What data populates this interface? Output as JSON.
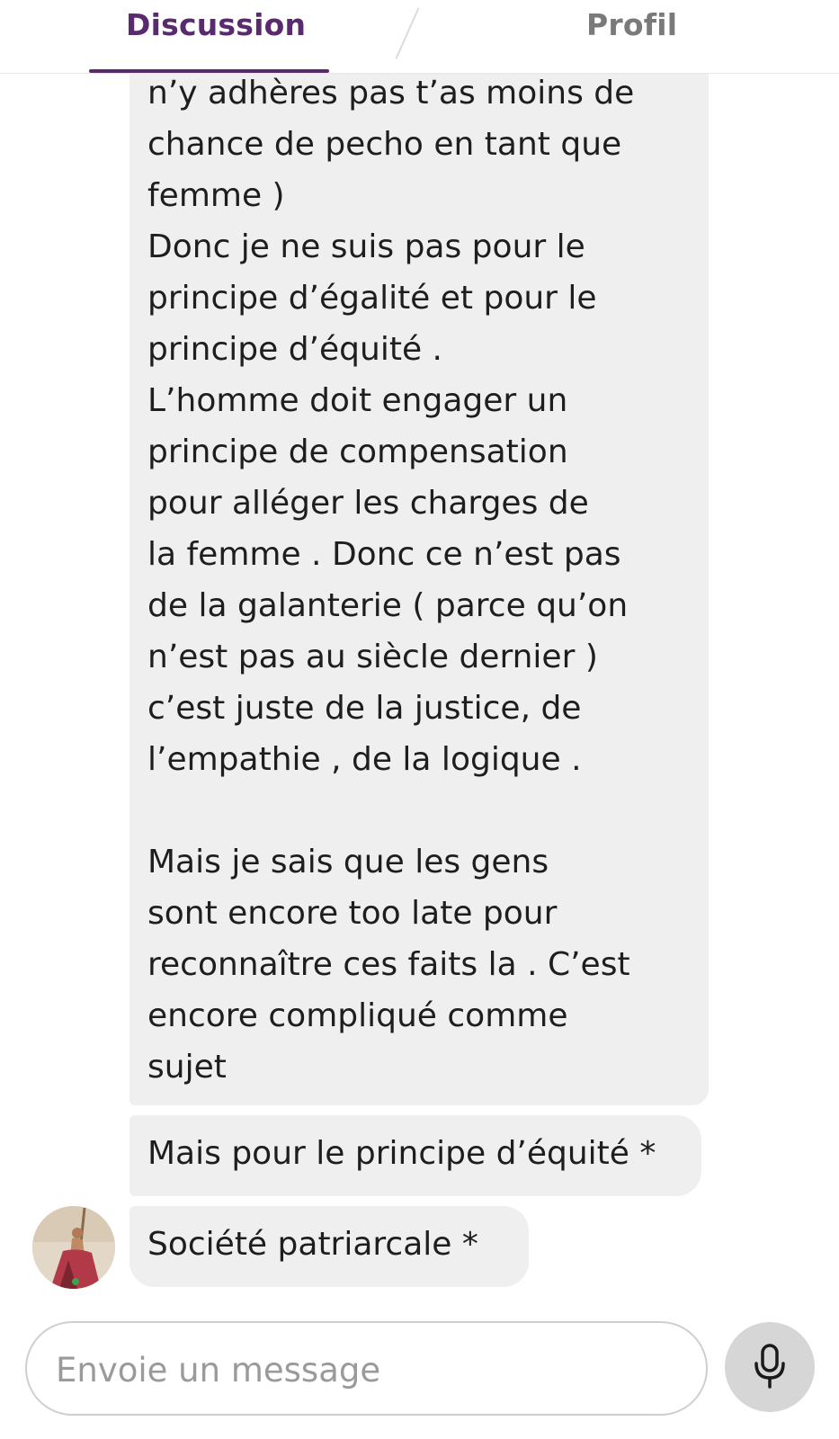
{
  "tabs": {
    "discussion": "Discussion",
    "profil": "Profil"
  },
  "messages": [
    {
      "text": "n’y adhères pas t’as moins de\nchance de pecho en tant que\nfemme )\nDonc je ne suis pas pour le\nprincipe d’égalité et pour le\nprincipe d’équité .\nL’homme doit engager un\nprincipe de compensation\npour alléger les charges de\nla femme . Donc ce n’est pas\nde la galanterie ( parce qu’on\nn’est pas au siècle dernier )\nc’est juste de la justice, de\nl’empathie , de la logique .\n\nMais je sais que les gens\nsont encore too late pour\nreconnaître ces faits la . C’est\nencore compliqué comme\nsujet"
    },
    {
      "text": "Mais pour le principe d’équité *"
    },
    {
      "text": "Société patriarcale *"
    }
  ],
  "composer": {
    "placeholder": "Envoie un message"
  },
  "icons": {
    "mic": "microphone-icon",
    "avatar": "contact-avatar"
  },
  "colors": {
    "accent": "#5a2a6e",
    "bubble": "#efefef",
    "mic_button": "#d6d6d6"
  }
}
